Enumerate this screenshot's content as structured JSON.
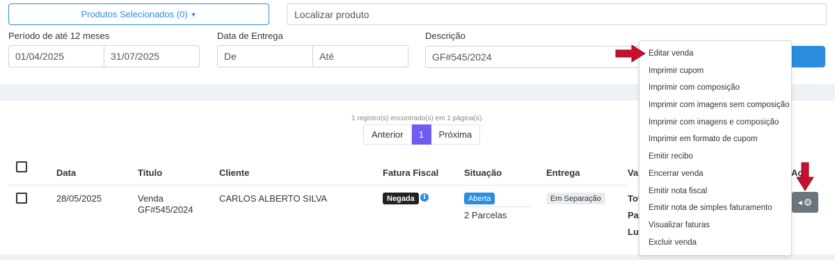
{
  "toolbar": {
    "products_button": "Produtos Selecionados (0)",
    "search_placeholder": "Localizar produto"
  },
  "filters": {
    "period_label": "Período de até 12 meses",
    "period_from": "01/04/2025",
    "period_to": "31/07/2025",
    "delivery_label": "Data de Entrega",
    "delivery_from_placeholder": "De",
    "delivery_to_placeholder": "Até",
    "description_label": "Descrição",
    "description_value": "GF#545/2024"
  },
  "results": {
    "records_text": "1 registro(s) encontrado(s) em 1 página(s).",
    "pagination": {
      "prev": "Anterior",
      "current": "1",
      "next": "Próxima"
    }
  },
  "table": {
    "headers": {
      "date": "Data",
      "title": "Titulo",
      "client": "Cliente",
      "invoice": "Fatura Fiscal",
      "status": "Situação",
      "delivery": "Entrega",
      "value": "Val",
      "actions": "Aç"
    },
    "rows": [
      {
        "date": "28/05/2025",
        "title_line1": "Venda",
        "title_line2": "GF#545/2024",
        "client": "CARLOS ALBERTO SILVA",
        "invoice_badge": "Negada",
        "status_badge": "Aberta",
        "installments": "2 Parcelas",
        "delivery_badge": "Em Separação",
        "value_line1": "Tot",
        "value_line2": "Par",
        "value_line3": "Luc"
      }
    ]
  },
  "actions_menu": {
    "items": [
      "Editar venda",
      "Imprimir cupom",
      "Imprimir com composição",
      "Imprimir com imagens sem composição",
      "Imprimir com imagens e composição",
      "Imprimir em formato de cupom",
      "Emitir recibo",
      "Encerrar venda",
      "Emitir nota fiscal",
      "Emitir nota de simples faturamento",
      "Visualizar faturas",
      "Excluir venda"
    ]
  },
  "colors": {
    "primary": "#2b8ce0",
    "page_active": "#6f5cf0",
    "arrow": "#c8102e",
    "gear_button": "#6c757d"
  }
}
